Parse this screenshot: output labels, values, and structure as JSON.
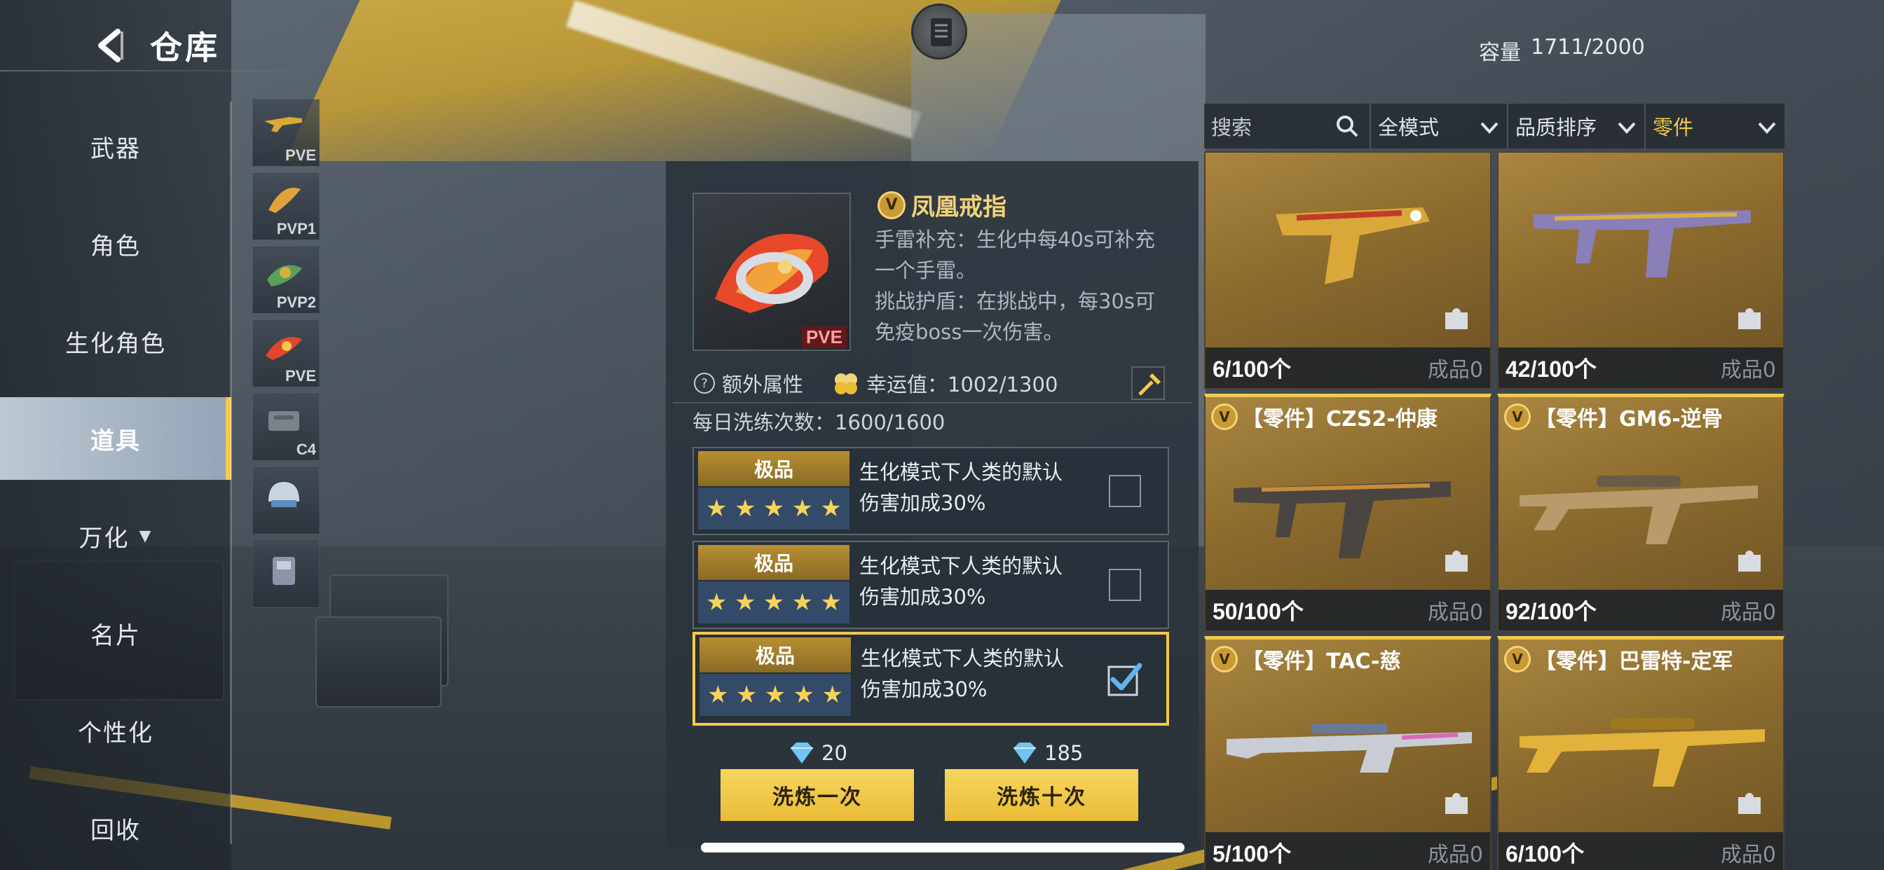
{
  "header": {
    "title": "仓库",
    "capacity_label": "容量",
    "capacity_value": "1711/2000"
  },
  "nav": [
    {
      "label": "武器",
      "active": false
    },
    {
      "label": "角色",
      "active": false
    },
    {
      "label": "生化角色",
      "active": false
    },
    {
      "label": "道具",
      "active": true
    },
    {
      "label": "万化",
      "active": false,
      "has_arrow": true
    },
    {
      "label": "名片",
      "active": false
    },
    {
      "label": "个性化",
      "active": false
    },
    {
      "label": "回收",
      "active": false
    }
  ],
  "thumbs": [
    {
      "tag": "PVE"
    },
    {
      "tag": "PVP1"
    },
    {
      "tag": "PVP2"
    },
    {
      "tag": "PVE"
    },
    {
      "tag": "C4"
    },
    {
      "tag": ""
    },
    {
      "tag": ""
    }
  ],
  "detail": {
    "name": "凤凰戒指",
    "rank": "V",
    "img_tag": "PVE",
    "desc": [
      "手雷补充：生化中每40s可补充",
      "一个手雷。",
      "挑战护盾：在挑战中，每30s可",
      "免疫boss一次伤害。"
    ],
    "extra_attr_label": "额外属性",
    "lucky_label": "幸运值：1002/1300",
    "daily_label": "每日洗练次数：1600/1600",
    "options": [
      {
        "quality": "极品",
        "stars": 5,
        "text1": "生化模式下人类的默认",
        "text2": "伤害加成30%",
        "checked": false
      },
      {
        "quality": "极品",
        "stars": 5,
        "text1": "生化模式下人类的默认",
        "text2": "伤害加成30%",
        "checked": false
      },
      {
        "quality": "极品",
        "stars": 5,
        "text1": "生化模式下人类的默认",
        "text2": "伤害加成30%",
        "checked": true
      }
    ],
    "cost_once": "20",
    "cost_ten": "185",
    "refine_once_label": "洗炼一次",
    "refine_ten_label": "洗炼十次"
  },
  "filters": {
    "search_placeholder": "搜索",
    "mode": "全模式",
    "sort": "品质排序",
    "category": "零件"
  },
  "cards": [
    {
      "name": "",
      "count": "6/100个",
      "made": "成品0",
      "framed": false,
      "gun_color": "#d9a838"
    },
    {
      "name": "",
      "count": "42/100个",
      "made": "成品0",
      "framed": false,
      "gun_color": "#8a7fb8"
    },
    {
      "name": "【零件】CZS2-仲康",
      "count": "50/100个",
      "made": "成品0",
      "framed": true,
      "gun_color": "#5a5148"
    },
    {
      "name": "【零件】GM6-逆骨",
      "count": "92/100个",
      "made": "成品0",
      "framed": true,
      "gun_color": "#b99a6a"
    },
    {
      "name": "【零件】TAC-慈",
      "count": "5/100个",
      "made": "成品0",
      "framed": true,
      "gun_color": "#c8ccd4"
    },
    {
      "name": "【零件】巴雷特-定军",
      "count": "6/100个",
      "made": "成品0",
      "framed": true,
      "gun_color": "#e2b23a"
    }
  ],
  "colors": {
    "accent": "#f2c94c",
    "card_bg": "#8b6a2d",
    "panel_bg": "#2a323a"
  }
}
